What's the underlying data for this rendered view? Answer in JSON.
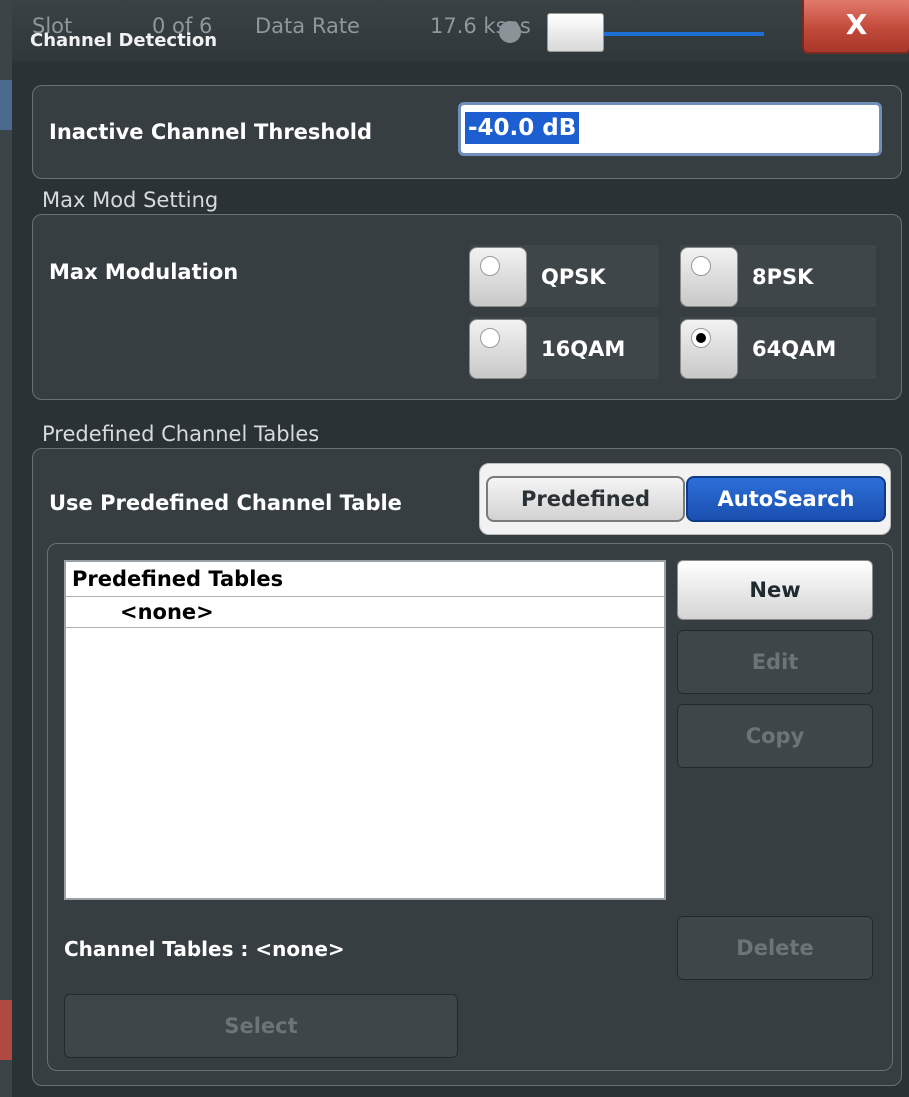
{
  "titlebar": {
    "title": "Channel Detection",
    "ghost_slot": "Slot",
    "ghost_slot_value": "0 of 6",
    "ghost_data_rate": "Data Rate",
    "ghost_rate_value": "17.6 ksps",
    "close_label": "X"
  },
  "threshold": {
    "label": "Inactive Channel Threshold",
    "value": "-40.0 dB"
  },
  "max_mod": {
    "section_title": "Max Mod Setting",
    "label": "Max Modulation",
    "options": [
      {
        "label": "QPSK",
        "selected": false
      },
      {
        "label": "8PSK",
        "selected": false
      },
      {
        "label": "16QAM",
        "selected": false
      },
      {
        "label": "64QAM",
        "selected": true
      }
    ]
  },
  "predefined": {
    "section_title": "Predefined Channel Tables",
    "use_label": "Use Predefined Channel Table",
    "toggle_predefined": "Predefined",
    "toggle_autosearch": "AutoSearch",
    "active_toggle": "AutoSearch",
    "table_header": "Predefined Tables",
    "table_rows": [
      "<none>"
    ],
    "buttons": {
      "new": "New",
      "edit": "Edit",
      "copy": "Copy",
      "delete": "Delete",
      "select": "Select"
    },
    "channel_tables_label": "Channel Tables : <none>"
  }
}
